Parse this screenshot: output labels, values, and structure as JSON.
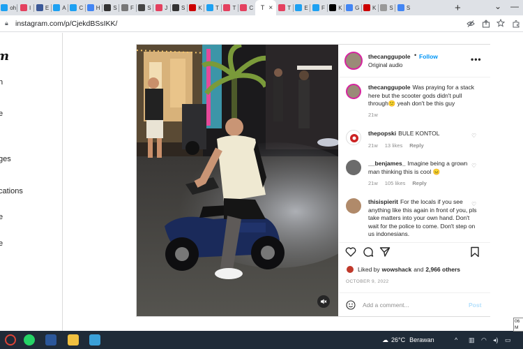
{
  "browser": {
    "tabs": [
      {
        "label": "oh",
        "color": "#1da1f2"
      },
      {
        "label": "I",
        "color": "#e4405f"
      },
      {
        "label": "E",
        "color": "#3b5998"
      },
      {
        "label": "A",
        "color": "#1da1f2"
      },
      {
        "label": "C",
        "color": "#1da1f2"
      },
      {
        "label": "H",
        "color": "#4285f4"
      },
      {
        "label": "S",
        "color": "#333333"
      },
      {
        "label": "F",
        "color": "#777777"
      },
      {
        "label": "S",
        "color": "#444444"
      },
      {
        "label": "J",
        "color": "#e4405f"
      },
      {
        "label": "S",
        "color": "#333333"
      },
      {
        "label": "K",
        "color": "#cc0000"
      },
      {
        "label": "T",
        "color": "#1da1f2"
      },
      {
        "label": "T",
        "color": "#e4405f"
      },
      {
        "label": "C",
        "color": "#e4405f"
      },
      {
        "label": "T",
        "color": "#ffffff",
        "active": true
      },
      {
        "label": "T",
        "color": "#e4405f"
      },
      {
        "label": "E",
        "color": "#1da1f2"
      },
      {
        "label": "F",
        "color": "#1da1f2"
      },
      {
        "label": "K",
        "color": "#000000"
      },
      {
        "label": "G",
        "color": "#4285f4"
      },
      {
        "label": "K",
        "color": "#cc0000"
      },
      {
        "label": "S",
        "color": "#999999"
      },
      {
        "label": "S",
        "color": "#4285f4"
      }
    ],
    "active_tab_close": "×",
    "new_tab": "+",
    "url": "instagram.com/p/CjekdBSsIKK/"
  },
  "sidebar": {
    "logo_fragment": "m",
    "items": [
      "h",
      "e",
      "ges",
      "cations",
      "e",
      "e"
    ]
  },
  "post": {
    "author": "thecanggupole",
    "separator": "•",
    "follow_label": "Follow",
    "audio_label": "Original audio",
    "more_label": "•••",
    "caption": {
      "user": "thecanggupole",
      "text": "Was praying for a stack here but the scooter gods didn't pull through😕 yeah don't be this guy",
      "time": "21w"
    },
    "comments": [
      {
        "user": "thepopski",
        "text": "BULE KONTOL",
        "time": "21w",
        "likes": "13 likes",
        "reply": "Reply"
      },
      {
        "user": "__benjames_",
        "text": "Imagine being a grown man thinking this is cool 😑",
        "time": "21w",
        "likes": "105 likes",
        "reply": "Reply"
      },
      {
        "user": "thisispierit",
        "text": "For the locals if you see anything like this again in front of you, pls take matters into your own hand. Don't wait for the police to come. Don't step on us indonesians."
      }
    ],
    "liked_by_prefix": "Liked by",
    "liked_by_user": "wowshack",
    "liked_by_and": "and",
    "liked_by_count": "2,966 others",
    "date": "OCTOBER 9, 2022",
    "add_comment_placeholder": "Add a comment...",
    "post_button": "Post"
  },
  "taskbar": {
    "temperature": "26°C",
    "condition": "Berawan",
    "clock_line1": "06 M",
    "clock_line2": "Mo"
  }
}
